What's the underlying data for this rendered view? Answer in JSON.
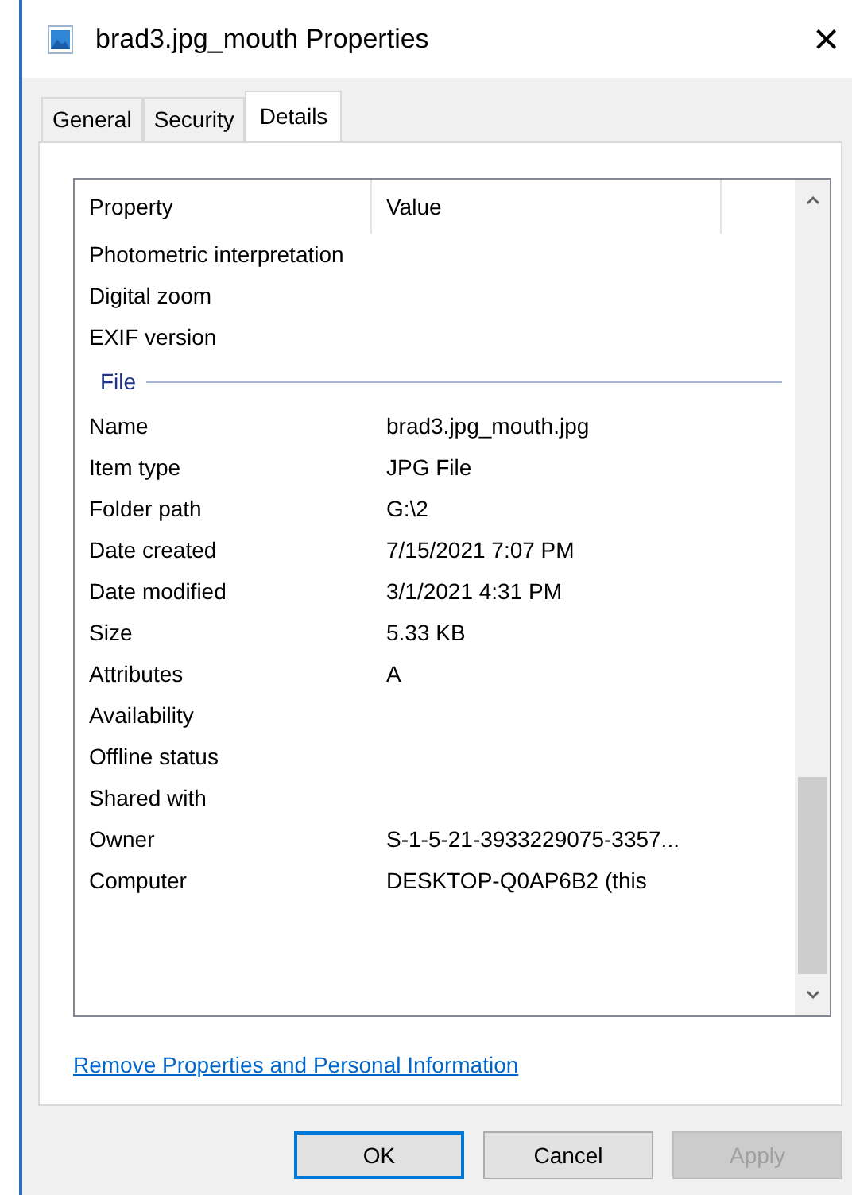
{
  "window": {
    "title": "brad3.jpg_mouth Properties",
    "close": "×"
  },
  "tabs": [
    {
      "label": "General",
      "selected": false
    },
    {
      "label": "Security",
      "selected": false
    },
    {
      "label": "Details",
      "selected": true
    }
  ],
  "table": {
    "columns": [
      "Property",
      "Value"
    ],
    "rows": [
      {
        "kind": "row",
        "property": "Photometric interpretation"
      },
      {
        "kind": "row",
        "property": "Digital zoom"
      },
      {
        "kind": "row",
        "property": "EXIF version"
      },
      {
        "kind": "section",
        "property": "File"
      },
      {
        "kind": "row",
        "property": "Name",
        "value": "brad3.jpg_mouth.jpg"
      },
      {
        "kind": "row",
        "property": "Item type",
        "value": "JPG File"
      },
      {
        "kind": "row",
        "property": "Folder path",
        "value": "G:\\2"
      },
      {
        "kind": "row",
        "property": "Date created",
        "value": "7/15/2021 7:07 PM"
      },
      {
        "kind": "row",
        "property": "Date modified",
        "value": "3/1/2021 4:31 PM"
      },
      {
        "kind": "row",
        "property": "Size",
        "value": "5.33 KB"
      },
      {
        "kind": "row",
        "property": "Attributes",
        "value": "A"
      },
      {
        "kind": "row",
        "property": "Availability"
      },
      {
        "kind": "row",
        "property": "Offline status"
      },
      {
        "kind": "row",
        "property": "Shared with"
      },
      {
        "kind": "row",
        "property": "Owner",
        "value": "S-1-5-21-3933229075-3357..."
      },
      {
        "kind": "row",
        "property": "Computer",
        "value": "DESKTOP-Q0AP6B2 (this"
      }
    ]
  },
  "link": "Remove Properties and Personal Information",
  "buttons": [
    {
      "label": "OK",
      "default": true,
      "disabled": false
    },
    {
      "label": "Cancel",
      "default": false,
      "disabled": false
    },
    {
      "label": "Apply",
      "default": false,
      "disabled": true
    }
  ]
}
